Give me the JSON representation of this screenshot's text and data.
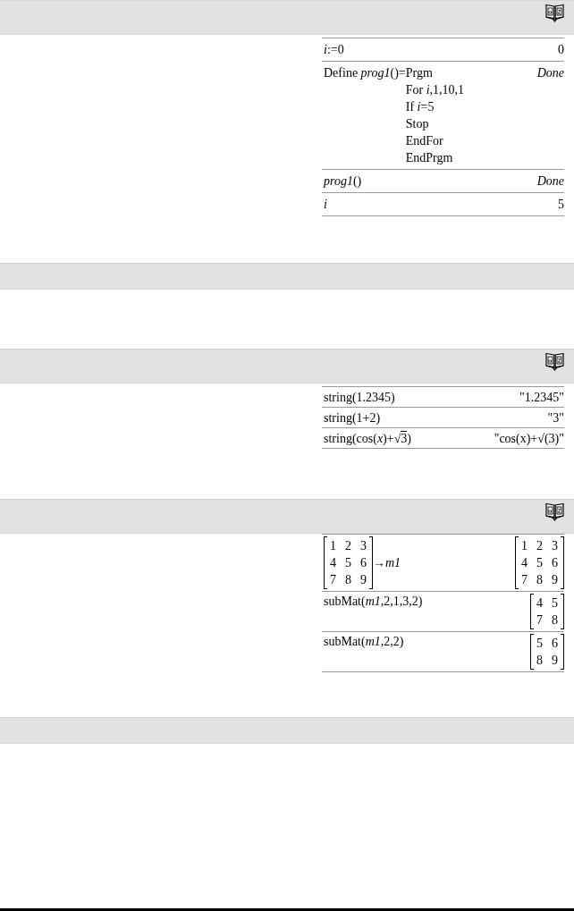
{
  "sections": [
    {
      "catalog": true,
      "examples": [
        {
          "input": [
            {
              "kind": "text",
              "text": "*i*:=0",
              "italic": false
            }
          ],
          "output": [
            {
              "kind": "text",
              "text": "0",
              "italic": false
            }
          ]
        },
        {
          "input": [
            {
              "kind": "text",
              "text": "Define *prog1*()=",
              "italic": false
            }
          ],
          "program": [
            "Prgm",
            "For *i*,1,10,1",
            "If *i*=5",
            "Stop",
            "EndFor",
            "EndPrgm"
          ],
          "output": [
            {
              "kind": "text",
              "text": "Done",
              "italic": true
            }
          ]
        },
        {
          "input": [
            {
              "kind": "text",
              "text": "*prog1*()",
              "italic": false
            }
          ],
          "output": [
            {
              "kind": "text",
              "text": "Done",
              "italic": true
            }
          ]
        },
        {
          "input": [
            {
              "kind": "text",
              "text": "i",
              "italic": true
            }
          ],
          "output": [
            {
              "kind": "text",
              "text": "5",
              "italic": false
            }
          ]
        }
      ]
    },
    {
      "catalog": false
    },
    {
      "catalog": true,
      "examples": [
        {
          "input": [
            {
              "kind": "text",
              "text": "string(1.2345)",
              "italic": false
            }
          ],
          "output": [
            {
              "kind": "text",
              "text": "\"1.2345\"",
              "italic": false
            }
          ]
        },
        {
          "input": [
            {
              "kind": "text",
              "text": "string(1+2)",
              "italic": false
            }
          ],
          "output": [
            {
              "kind": "text",
              "text": "\"3\"",
              "italic": false
            }
          ]
        },
        {
          "input": [
            {
              "kind": "text",
              "text": "string(cos(*x*)+√",
              "italic": false
            },
            {
              "kind": "overline",
              "text": "3"
            },
            {
              "kind": "text",
              "text": ")",
              "italic": false
            }
          ],
          "output": [
            {
              "kind": "text",
              "text": "\"cos(x)+√(3)\"",
              "italic": false
            }
          ]
        }
      ]
    },
    {
      "catalog": true,
      "examples": [
        {
          "input": [
            {
              "kind": "matrix",
              "rows": [
                [
                  "1",
                  "2",
                  "3"
                ],
                [
                  "4",
                  "5",
                  "6"
                ],
                [
                  "7",
                  "8",
                  "9"
                ]
              ]
            },
            {
              "kind": "text",
              "text": "→*m1*"
            }
          ],
          "output": [
            {
              "kind": "matrix",
              "rows": [
                [
                  "1",
                  "2",
                  "3"
                ],
                [
                  "4",
                  "5",
                  "6"
                ],
                [
                  "7",
                  "8",
                  "9"
                ]
              ]
            }
          ]
        },
        {
          "input": [
            {
              "kind": "text",
              "text": "subMat(*m1*,2,1,3,2)",
              "italic": false
            }
          ],
          "output": [
            {
              "kind": "matrix",
              "rows": [
                [
                  "4",
                  "5"
                ],
                [
                  "7",
                  "8"
                ]
              ]
            }
          ]
        },
        {
          "input": [
            {
              "kind": "text",
              "text": "subMat(*m1*,2,2)",
              "italic": false
            }
          ],
          "output": [
            {
              "kind": "matrix",
              "rows": [
                [
                  "5",
                  "6"
                ],
                [
                  "8",
                  "9"
                ]
              ]
            }
          ]
        }
      ]
    },
    {
      "catalog": false
    }
  ]
}
